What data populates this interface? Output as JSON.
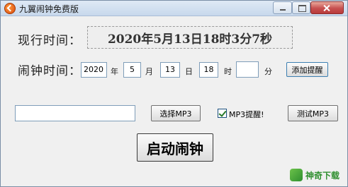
{
  "window": {
    "title": "九翼闹钟免费版",
    "app_icon": "app-logo-icon"
  },
  "clock": {
    "current_label": "现行时间：",
    "current_time": "2020年5月13日18时3分7秒"
  },
  "alarm": {
    "label": "闹钟时间：",
    "year_value": "2020",
    "year_unit": "年",
    "month_value": "5",
    "month_unit": "月",
    "day_value": "13",
    "day_unit": "日",
    "hour_value": "18",
    "hour_unit": "时",
    "minute_value": "",
    "minute_unit": "分",
    "add_button": "添加提醒"
  },
  "mp3": {
    "path_value": "",
    "choose_button": "选择MP3",
    "reminder_label": "MP3提醒!",
    "reminder_checked": true,
    "test_button": "测试MP3"
  },
  "start_button": "启动闹钟",
  "watermark": {
    "text": "神奇下载"
  }
}
